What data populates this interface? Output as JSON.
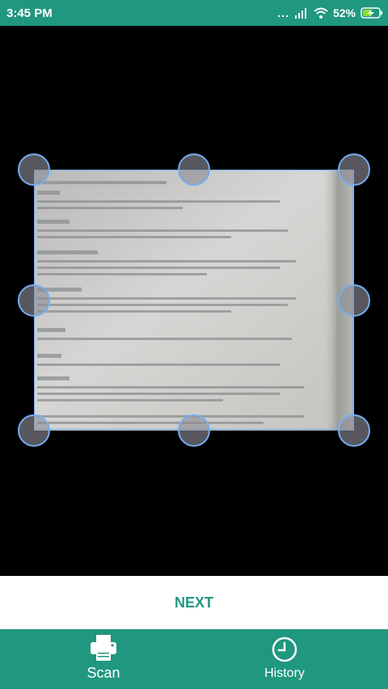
{
  "status_bar": {
    "time": "3:45 PM",
    "signal_dots": "...",
    "battery_percent": "52%",
    "icons": [
      "signal-icon",
      "wifi-icon",
      "battery-charging-icon"
    ]
  },
  "crop_view": {
    "handles": [
      "top-left",
      "top-center",
      "top-right",
      "middle-left",
      "middle-right",
      "bottom-left",
      "bottom-center",
      "bottom-right"
    ]
  },
  "actions": {
    "next_label": "NEXT"
  },
  "bottom_nav": {
    "items": [
      {
        "label": "Scan",
        "icon": "printer-icon"
      },
      {
        "label": "History",
        "icon": "clock-icon"
      }
    ]
  },
  "colors": {
    "primary": "#20977f",
    "frame": "#74aef0"
  }
}
